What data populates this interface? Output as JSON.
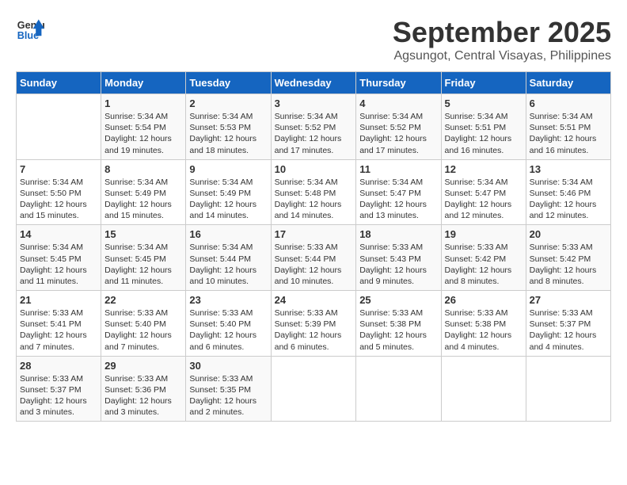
{
  "header": {
    "logo_line1": "General",
    "logo_line2": "Blue",
    "month": "September 2025",
    "location": "Agsungot, Central Visayas, Philippines"
  },
  "weekdays": [
    "Sunday",
    "Monday",
    "Tuesday",
    "Wednesday",
    "Thursday",
    "Friday",
    "Saturday"
  ],
  "weeks": [
    [
      {
        "day": "",
        "text": ""
      },
      {
        "day": "1",
        "text": "Sunrise: 5:34 AM\nSunset: 5:54 PM\nDaylight: 12 hours\nand 19 minutes."
      },
      {
        "day": "2",
        "text": "Sunrise: 5:34 AM\nSunset: 5:53 PM\nDaylight: 12 hours\nand 18 minutes."
      },
      {
        "day": "3",
        "text": "Sunrise: 5:34 AM\nSunset: 5:52 PM\nDaylight: 12 hours\nand 17 minutes."
      },
      {
        "day": "4",
        "text": "Sunrise: 5:34 AM\nSunset: 5:52 PM\nDaylight: 12 hours\nand 17 minutes."
      },
      {
        "day": "5",
        "text": "Sunrise: 5:34 AM\nSunset: 5:51 PM\nDaylight: 12 hours\nand 16 minutes."
      },
      {
        "day": "6",
        "text": "Sunrise: 5:34 AM\nSunset: 5:51 PM\nDaylight: 12 hours\nand 16 minutes."
      }
    ],
    [
      {
        "day": "7",
        "text": "Sunrise: 5:34 AM\nSunset: 5:50 PM\nDaylight: 12 hours\nand 15 minutes."
      },
      {
        "day": "8",
        "text": "Sunrise: 5:34 AM\nSunset: 5:49 PM\nDaylight: 12 hours\nand 15 minutes."
      },
      {
        "day": "9",
        "text": "Sunrise: 5:34 AM\nSunset: 5:49 PM\nDaylight: 12 hours\nand 14 minutes."
      },
      {
        "day": "10",
        "text": "Sunrise: 5:34 AM\nSunset: 5:48 PM\nDaylight: 12 hours\nand 14 minutes."
      },
      {
        "day": "11",
        "text": "Sunrise: 5:34 AM\nSunset: 5:47 PM\nDaylight: 12 hours\nand 13 minutes."
      },
      {
        "day": "12",
        "text": "Sunrise: 5:34 AM\nSunset: 5:47 PM\nDaylight: 12 hours\nand 12 minutes."
      },
      {
        "day": "13",
        "text": "Sunrise: 5:34 AM\nSunset: 5:46 PM\nDaylight: 12 hours\nand 12 minutes."
      }
    ],
    [
      {
        "day": "14",
        "text": "Sunrise: 5:34 AM\nSunset: 5:45 PM\nDaylight: 12 hours\nand 11 minutes."
      },
      {
        "day": "15",
        "text": "Sunrise: 5:34 AM\nSunset: 5:45 PM\nDaylight: 12 hours\nand 11 minutes."
      },
      {
        "day": "16",
        "text": "Sunrise: 5:34 AM\nSunset: 5:44 PM\nDaylight: 12 hours\nand 10 minutes."
      },
      {
        "day": "17",
        "text": "Sunrise: 5:33 AM\nSunset: 5:44 PM\nDaylight: 12 hours\nand 10 minutes."
      },
      {
        "day": "18",
        "text": "Sunrise: 5:33 AM\nSunset: 5:43 PM\nDaylight: 12 hours\nand 9 minutes."
      },
      {
        "day": "19",
        "text": "Sunrise: 5:33 AM\nSunset: 5:42 PM\nDaylight: 12 hours\nand 8 minutes."
      },
      {
        "day": "20",
        "text": "Sunrise: 5:33 AM\nSunset: 5:42 PM\nDaylight: 12 hours\nand 8 minutes."
      }
    ],
    [
      {
        "day": "21",
        "text": "Sunrise: 5:33 AM\nSunset: 5:41 PM\nDaylight: 12 hours\nand 7 minutes."
      },
      {
        "day": "22",
        "text": "Sunrise: 5:33 AM\nSunset: 5:40 PM\nDaylight: 12 hours\nand 7 minutes."
      },
      {
        "day": "23",
        "text": "Sunrise: 5:33 AM\nSunset: 5:40 PM\nDaylight: 12 hours\nand 6 minutes."
      },
      {
        "day": "24",
        "text": "Sunrise: 5:33 AM\nSunset: 5:39 PM\nDaylight: 12 hours\nand 6 minutes."
      },
      {
        "day": "25",
        "text": "Sunrise: 5:33 AM\nSunset: 5:38 PM\nDaylight: 12 hours\nand 5 minutes."
      },
      {
        "day": "26",
        "text": "Sunrise: 5:33 AM\nSunset: 5:38 PM\nDaylight: 12 hours\nand 4 minutes."
      },
      {
        "day": "27",
        "text": "Sunrise: 5:33 AM\nSunset: 5:37 PM\nDaylight: 12 hours\nand 4 minutes."
      }
    ],
    [
      {
        "day": "28",
        "text": "Sunrise: 5:33 AM\nSunset: 5:37 PM\nDaylight: 12 hours\nand 3 minutes."
      },
      {
        "day": "29",
        "text": "Sunrise: 5:33 AM\nSunset: 5:36 PM\nDaylight: 12 hours\nand 3 minutes."
      },
      {
        "day": "30",
        "text": "Sunrise: 5:33 AM\nSunset: 5:35 PM\nDaylight: 12 hours\nand 2 minutes."
      },
      {
        "day": "",
        "text": ""
      },
      {
        "day": "",
        "text": ""
      },
      {
        "day": "",
        "text": ""
      },
      {
        "day": "",
        "text": ""
      }
    ]
  ]
}
